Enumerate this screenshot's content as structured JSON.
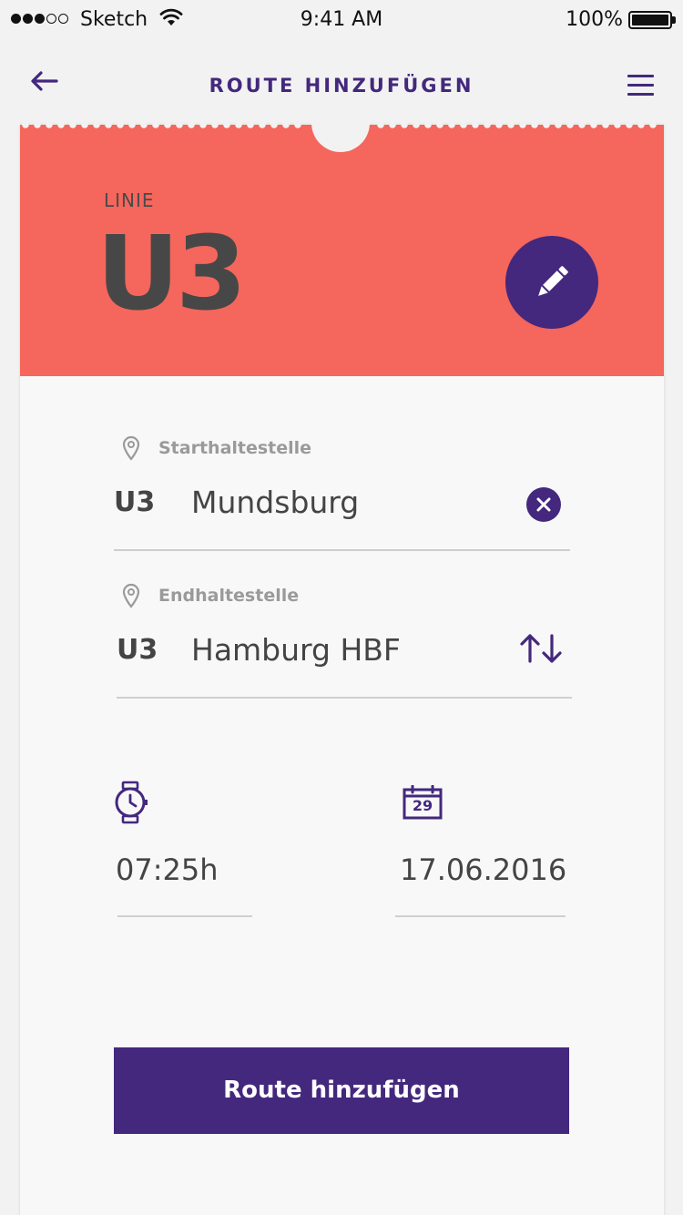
{
  "status_bar": {
    "carrier": "Sketch",
    "time": "9:41 AM",
    "battery": "100%"
  },
  "nav": {
    "title": "ROUTE HINZUFÜGEN"
  },
  "ticket": {
    "line_label": "LINIE",
    "line": "U3"
  },
  "start": {
    "label": "Starthaltestelle",
    "line": "U3",
    "stop": "Mundsburg"
  },
  "end": {
    "label": "Endhaltestelle",
    "line": "U3",
    "stop": "Hamburg HBF"
  },
  "schedule": {
    "time": "07:25h",
    "date": "17.06.2016",
    "calendar_day": "29"
  },
  "submit_label": "Route hinzufügen",
  "colors": {
    "accent": "#43287d",
    "header": "#f5665c",
    "background": "#f2f2f2"
  }
}
